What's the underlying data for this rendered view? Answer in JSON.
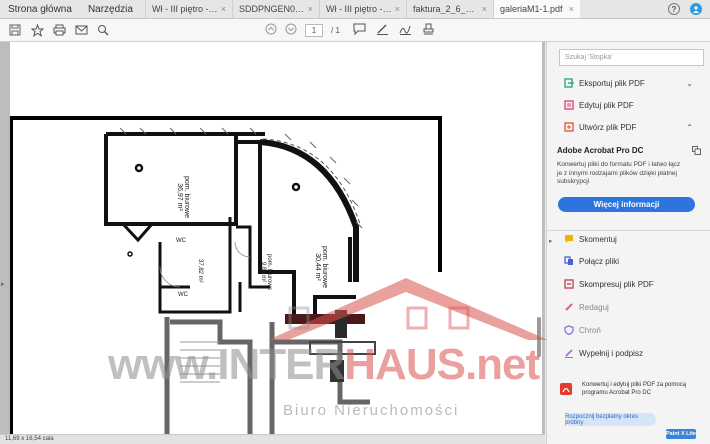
{
  "tabbar": {
    "home_label": "Strona główna",
    "tools_label": "Narzędzia",
    "tabs": [
      {
        "label": "Wł - III piętro - st...",
        "active": false
      },
      {
        "label": "SDDPNGEN0125...",
        "active": false
      },
      {
        "label": "Wł - III piętro - st...",
        "active": false
      },
      {
        "label": "faktura_2_6_2025...",
        "active": false
      },
      {
        "label": "galeriaM1-1.pdf",
        "active": true
      }
    ],
    "close_glyph": "×",
    "help_glyph": "?"
  },
  "toolbar": {
    "page_current": "1",
    "page_total": "/ 1",
    "icons": [
      "save-icon",
      "star-icon",
      "print-icon",
      "mail-icon",
      "zoom-icon",
      "page-up-icon",
      "page-down-icon",
      "comment-icon",
      "pen-icon",
      "sign-icon",
      "stamp-icon"
    ]
  },
  "document": {
    "rooms": [
      {
        "name": "pom. biurowe",
        "area": "36,97 m²"
      },
      {
        "name": "pom. biurowe",
        "area": "30,44 m²"
      },
      {
        "name": "pom. biurowe",
        "area": "9,86 m²"
      },
      {
        "name": "",
        "area": "37,82 m²"
      },
      {
        "name": "WC",
        "area": ""
      },
      {
        "name": "WC",
        "area": ""
      }
    ],
    "watermark": {
      "prefix": "www.INTER",
      "suffix": "HAUS.net",
      "tagline": "Biuro Nieruchomości"
    }
  },
  "status": {
    "page_size": "11,69 x 16,54 cala"
  },
  "rightpane": {
    "search_placeholder": "Szukaj 'Stopka'",
    "tools_top": [
      {
        "label": "Eksportuj plik PDF",
        "icon": "export-pdf-icon",
        "chevron": "⌄"
      },
      {
        "label": "Edytuj plik PDF",
        "icon": "edit-pdf-icon",
        "chevron": ""
      },
      {
        "label": "Utwórz plik PDF",
        "icon": "create-pdf-icon",
        "chevron": "⌃"
      }
    ],
    "promo": {
      "title": "Adobe Acrobat Pro DC",
      "text": "Konwertuj pliki do formatu PDF i łatwo łącz je z innymi rodzajami plików dzięki płatnej subskrypcji",
      "button": "Więcej informacji"
    },
    "tools_bottom": [
      {
        "label": "Skomentuj",
        "icon": "comment-tool-icon",
        "dim": false
      },
      {
        "label": "Połącz pliki",
        "icon": "combine-files-icon",
        "dim": false
      },
      {
        "label": "Skompresuj plik PDF",
        "icon": "compress-pdf-icon",
        "dim": false
      },
      {
        "label": "Redaguj",
        "icon": "redact-icon",
        "dim": true
      },
      {
        "label": "Chroń",
        "icon": "protect-icon",
        "dim": true
      },
      {
        "label": "Wypełnij i podpisz",
        "icon": "fill-sign-icon",
        "dim": false
      }
    ],
    "footer": {
      "text": "Konwertuj i edytuj pliki PDF za pomocą programu Acrobat Pro DC",
      "button": "Rozpocznij bezpłatny okres próbny",
      "badge": "Paint X Lite"
    }
  },
  "colors": {
    "accent": "#2c75de",
    "export": "#2aa56f",
    "edit": "#d8416e",
    "create": "#e25236",
    "comment": "#f0b400",
    "combine": "#4a5fd6",
    "compress": "#c63a52",
    "redact": "#d4609a",
    "protect": "#8a72d8",
    "fill": "#a06bd4",
    "watermark_red": "#d9534f",
    "watermark_gray": "#8e8e8e"
  }
}
